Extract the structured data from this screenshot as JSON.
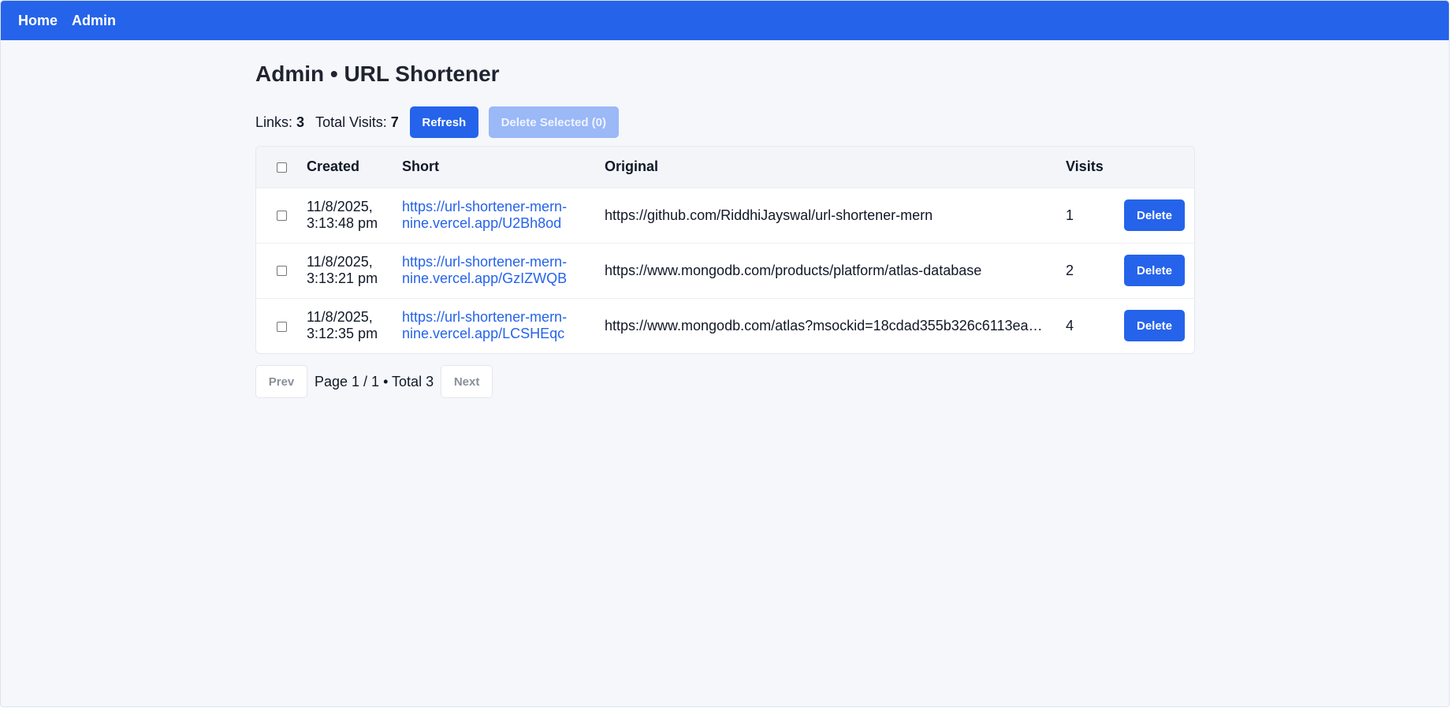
{
  "nav": {
    "home": "Home",
    "admin": "Admin"
  },
  "title": "Admin • URL Shortener",
  "stats": {
    "links_label": "Links:",
    "links_value": "3",
    "visits_label": "Total Visits:",
    "visits_value": "7"
  },
  "toolbar": {
    "refresh_label": "Refresh",
    "delete_selected_label": "Delete Selected (0)"
  },
  "table": {
    "headers": {
      "created": "Created",
      "short": "Short",
      "original": "Original",
      "visits": "Visits"
    },
    "rows": [
      {
        "created_date": "11/8/2025,",
        "created_time": "3:13:48 pm",
        "short_line1": "https://url-shortener-mern-",
        "short_line2": "nine.vercel.app/U2Bh8od",
        "original": "https://github.com/RiddhiJayswal/url-shortener-mern",
        "visits": "1",
        "delete_label": "Delete"
      },
      {
        "created_date": "11/8/2025,",
        "created_time": "3:13:21 pm",
        "short_line1": "https://url-shortener-mern-",
        "short_line2": "nine.vercel.app/GzIZWQB",
        "original": "https://www.mongodb.com/products/platform/atlas-database",
        "visits": "2",
        "delete_label": "Delete"
      },
      {
        "created_date": "11/8/2025,",
        "created_time": "3:12:35 pm",
        "short_line1": "https://url-shortener-mern-",
        "short_line2": "nine.vercel.app/LCSHEqc",
        "original": "https://www.mongodb.com/atlas?msockid=18cdad355b326c6113ea…",
        "visits": "4",
        "delete_label": "Delete"
      }
    ]
  },
  "pager": {
    "prev_label": "Prev",
    "next_label": "Next",
    "info": "Page 1 / 1 • Total 3"
  },
  "colors": {
    "primary": "#2563eb",
    "primary_disabled": "#9bb8f7",
    "background": "#f5f7fb"
  }
}
